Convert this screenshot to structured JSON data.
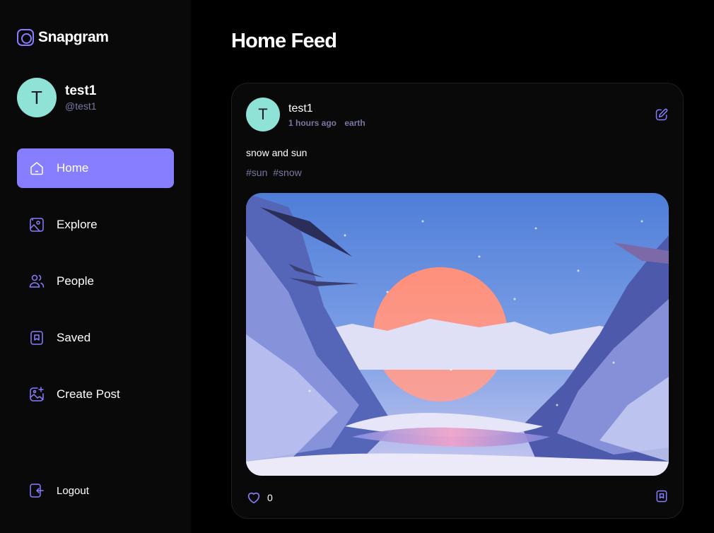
{
  "brand": {
    "name": "Snapgram"
  },
  "user": {
    "initial": "T",
    "name": "test1",
    "handle": "@test1"
  },
  "nav": {
    "items": [
      {
        "label": "Home"
      },
      {
        "label": "Explore"
      },
      {
        "label": "People"
      },
      {
        "label": "Saved"
      },
      {
        "label": "Create Post"
      }
    ],
    "logout_label": "Logout"
  },
  "page": {
    "title": "Home Feed"
  },
  "post": {
    "author_initial": "T",
    "author": "test1",
    "time": "1 hours ago",
    "location": "earth",
    "caption": "snow and sun",
    "tags": [
      "#sun",
      "#snow"
    ],
    "likes": "0"
  },
  "colors": {
    "accent": "#877eff",
    "avatar": "#8ee2d6",
    "muted": "#7878a3",
    "sidebar_bg": "#09090a"
  },
  "icons": [
    "logo-icon",
    "home-icon",
    "explore-icon",
    "people-icon",
    "saved-icon",
    "create-post-icon",
    "logout-icon",
    "edit-icon",
    "heart-icon",
    "bookmark-icon"
  ]
}
